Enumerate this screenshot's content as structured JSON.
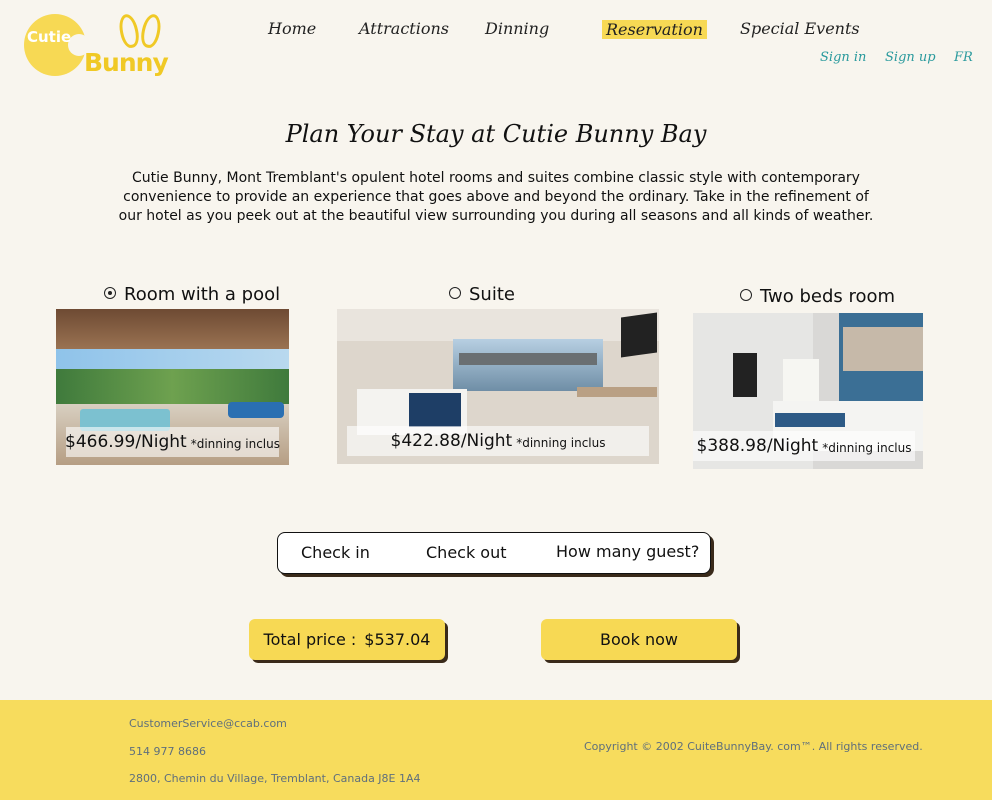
{
  "logo": {
    "line1": "Cutie",
    "line2": "Bunny"
  },
  "nav": {
    "items": [
      "Home",
      "Attractions",
      "Dinning",
      "Reservation",
      "Special Events"
    ],
    "active": "Reservation"
  },
  "account": {
    "sign_in": "Sign in",
    "sign_up": "Sign up",
    "language": "FR"
  },
  "page": {
    "title": "Plan Your Stay at Cutie Bunny Bay",
    "intro": "Cutie Bunny, Mont Tremblant's opulent hotel rooms and suites combine classic style with contemporary convenience to provide an experience that goes above and beyond the ordinary. Take in the refinement of our hotel as you peek out at the beautiful view surrounding you during all seasons and all kinds of weather."
  },
  "rooms": [
    {
      "name": "Room with a pool",
      "selected": true,
      "price": "$466.99/Night",
      "note": "*dinning inclus"
    },
    {
      "name": "Suite",
      "selected": false,
      "price": "$422.88/Night",
      "note": "*dinning inclus"
    },
    {
      "name": "Two beds room",
      "selected": false,
      "price": "$388.98/Night",
      "note": "*dinning inclus"
    }
  ],
  "booking": {
    "check_in": "Check in",
    "check_out": "Check out",
    "guests": "How many guest?"
  },
  "summary": {
    "total_label": "Total price :",
    "total_value": "$537.04",
    "book_button": "Book now"
  },
  "footer": {
    "email": "CustomerService@ccab.com",
    "phone": "514 977 8686",
    "address": "2800, Chemin du Village, Tremblant, Canada J8E 1A4",
    "copyright": "Copyright © 2002 CuiteBunnyBay. com™. All rights reserved."
  },
  "colors": {
    "accent": "#f7d954",
    "background": "#f8f5ee",
    "link": "#2a9a9d",
    "footer": "#f7dc5d"
  }
}
